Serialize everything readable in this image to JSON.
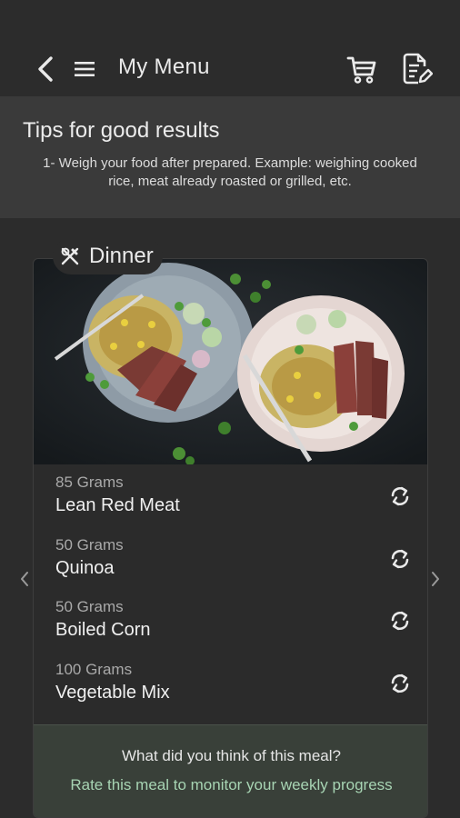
{
  "header": {
    "title": "My Menu",
    "icons": [
      "back-arrow-icon",
      "hamburger-menu-icon",
      "shopping-cart-icon",
      "edit-document-icon"
    ]
  },
  "tips": {
    "title": "Tips for good results",
    "text": "1- Weigh your food after prepared. Example: weighing cooked rice, meat already roasted or grilled, etc."
  },
  "meal": {
    "name": "Dinner",
    "icon": "utensils-icon",
    "foods": [
      {
        "qty": "85 Grams",
        "name": "Lean Red Meat"
      },
      {
        "qty": "50 Grams",
        "name": "Quinoa"
      },
      {
        "qty": "50 Grams",
        "name": "Boiled Corn"
      },
      {
        "qty": "100 Grams",
        "name": "Vegetable Mix"
      }
    ],
    "rating_question": "What did you think of this meal?",
    "rating_prompt": "Rate this meal to monitor your weekly progress"
  },
  "colors": {
    "background": "#2c2c2c",
    "tips_panel": "#3a3a3a",
    "rate_panel": "#394039",
    "accent_text": "#a7d4b3"
  }
}
